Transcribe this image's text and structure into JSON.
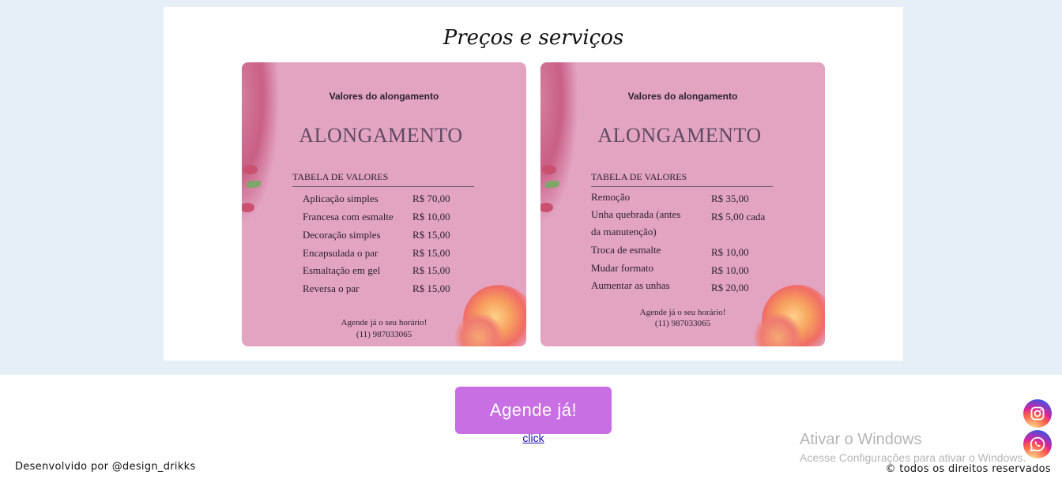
{
  "section": {
    "title": "Preços e serviços"
  },
  "cards": [
    {
      "subtitle": "Valores do alongamento",
      "heading": "ALONGAMENTO",
      "table_label": "TABELA DE VALORES",
      "rows": [
        {
          "service": "Aplicação simples",
          "price": "R$ 70,00"
        },
        {
          "service": "Francesa com  esmalte",
          "price": "R$ 10,00"
        },
        {
          "service": "Decoração simples",
          "price": "R$ 15,00"
        },
        {
          "service": "Encapsulada o par",
          "price": "R$ 15,00"
        },
        {
          "service": "Esmaltação em gel",
          "price": "R$ 15,00"
        },
        {
          "service": "Reversa o par",
          "price": "R$ 15,00"
        }
      ],
      "footer_line1": "Agende já o seu horário!",
      "footer_line2": "(11) 987033065"
    },
    {
      "subtitle": "Valores do alongamento",
      "heading": "ALONGAMENTO",
      "table_label": "TABELA DE VALORES",
      "rows": [
        {
          "service": "Remoção",
          "price": "R$ 35,00"
        },
        {
          "service": "Unha quebrada (antes",
          "price": "R$ 5,00 cada"
        },
        {
          "service": "da manutenção)",
          "price": ""
        },
        {
          "service": "Troca de esmalte",
          "price": "R$ 10,00"
        },
        {
          "service": "Mudar formato",
          "price": "R$ 10,00"
        },
        {
          "service": "Aumentar as unhas",
          "price": "R$ 20,00"
        }
      ],
      "footer_line1": "Agende já o seu horário!",
      "footer_line2": "(11) 987033065"
    }
  ],
  "cta": {
    "label": "Agende já!",
    "link_text": "click"
  },
  "footer": {
    "developer": "Desenvolvido por @design_drikks",
    "rights": "© todos os direitos reservados"
  },
  "windows_watermark": {
    "title": "Ativar o Windows",
    "subtitle": "Acesse Configurações para ativar o Windows."
  },
  "social": {
    "instagram_icon": "instagram-icon",
    "whatsapp_icon": "whatsapp-icon"
  },
  "colors": {
    "page_band": "#e6eef8",
    "card_pink": "#e3a4c2",
    "cta_purple": "#c86fe3"
  }
}
